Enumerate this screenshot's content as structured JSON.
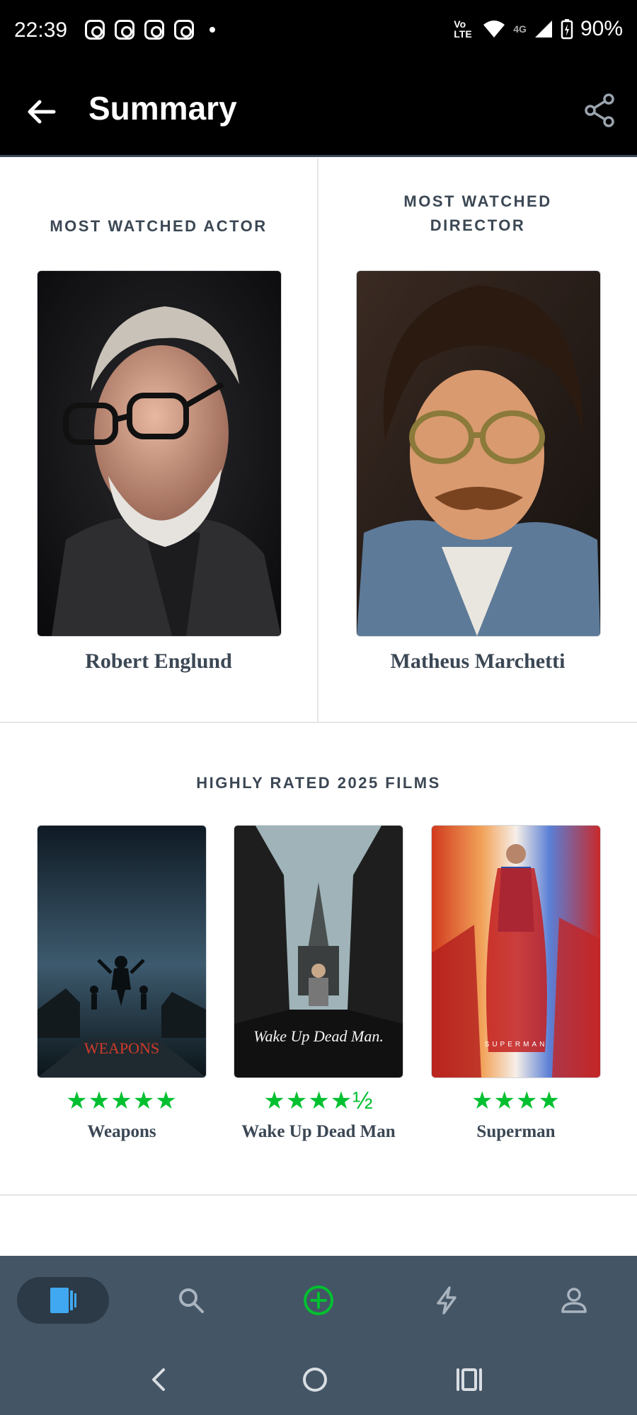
{
  "status_bar": {
    "time": "22:39",
    "network_small": "Vo LTE",
    "network_type": "4G",
    "battery": "90%"
  },
  "app_bar": {
    "title": "Summary"
  },
  "most_watched_actor": {
    "heading": "MOST WATCHED ACTOR",
    "name": "Robert Englund"
  },
  "most_watched_director": {
    "heading_line1": "MOST WATCHED",
    "heading_line2": "DIRECTOR",
    "name": "Matheus Marchetti"
  },
  "films_section": {
    "heading": "HIGHLY RATED 2025 FILMS",
    "films": [
      {
        "title": "Weapons",
        "rating_stars": "★★★★★",
        "poster_text": "WEAPONS"
      },
      {
        "title": "Wake Up Dead Man",
        "rating_stars": "★★★★½",
        "poster_text": "Wake Up Dead Man."
      },
      {
        "title": "Superman",
        "rating_stars": "★★★★",
        "poster_text": "SUPERMAN"
      }
    ]
  },
  "bottom_nav": {
    "items": [
      "films-icon",
      "search-icon",
      "add-icon",
      "activity-icon",
      "profile-icon"
    ],
    "active": "films-icon"
  },
  "colors": {
    "accent_green": "#00c030",
    "nav_bg": "#445566",
    "text_dark": "#3b4754",
    "active_blue": "#40a8f0"
  }
}
